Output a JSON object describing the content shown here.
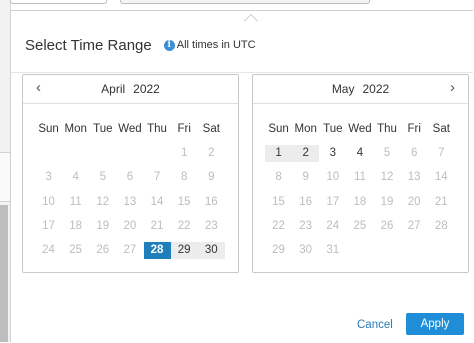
{
  "header": {
    "title": "Select Time Range",
    "info_icon": "i",
    "info_text": "All times in UTC"
  },
  "weekdays": [
    "Sun",
    "Mon",
    "Tue",
    "Wed",
    "Thu",
    "Fri",
    "Sat"
  ],
  "left_month": {
    "month": "April",
    "year": "2022",
    "prev_icon": "‹",
    "weeks": [
      [
        {
          "d": ""
        },
        {
          "d": ""
        },
        {
          "d": ""
        },
        {
          "d": ""
        },
        {
          "d": ""
        },
        {
          "d": "1"
        },
        {
          "d": "2"
        }
      ],
      [
        {
          "d": "3"
        },
        {
          "d": "4"
        },
        {
          "d": "5"
        },
        {
          "d": "6"
        },
        {
          "d": "7"
        },
        {
          "d": "8"
        },
        {
          "d": "9"
        }
      ],
      [
        {
          "d": "10"
        },
        {
          "d": "11"
        },
        {
          "d": "12"
        },
        {
          "d": "13"
        },
        {
          "d": "14"
        },
        {
          "d": "15"
        },
        {
          "d": "16"
        }
      ],
      [
        {
          "d": "17"
        },
        {
          "d": "18"
        },
        {
          "d": "19"
        },
        {
          "d": "20"
        },
        {
          "d": "21"
        },
        {
          "d": "22"
        },
        {
          "d": "23"
        }
      ],
      [
        {
          "d": "24"
        },
        {
          "d": "25"
        },
        {
          "d": "26"
        },
        {
          "d": "27"
        },
        {
          "d": "28",
          "s": "selected"
        },
        {
          "d": "29",
          "s": "range"
        },
        {
          "d": "30",
          "s": "range"
        }
      ]
    ]
  },
  "right_month": {
    "month": "May",
    "year": "2022",
    "next_icon": "›",
    "weeks": [
      [
        {
          "d": "1",
          "s": "range"
        },
        {
          "d": "2",
          "s": "range"
        },
        {
          "d": "3",
          "s": "active"
        },
        {
          "d": "4",
          "s": "active"
        },
        {
          "d": "5"
        },
        {
          "d": "6"
        },
        {
          "d": "7"
        }
      ],
      [
        {
          "d": "8"
        },
        {
          "d": "9"
        },
        {
          "d": "10"
        },
        {
          "d": "11"
        },
        {
          "d": "12"
        },
        {
          "d": "13"
        },
        {
          "d": "14"
        }
      ],
      [
        {
          "d": "15"
        },
        {
          "d": "16"
        },
        {
          "d": "17"
        },
        {
          "d": "18"
        },
        {
          "d": "19"
        },
        {
          "d": "20"
        },
        {
          "d": "21"
        }
      ],
      [
        {
          "d": "22"
        },
        {
          "d": "23"
        },
        {
          "d": "24"
        },
        {
          "d": "25"
        },
        {
          "d": "26"
        },
        {
          "d": "27"
        },
        {
          "d": "28"
        }
      ],
      [
        {
          "d": "29"
        },
        {
          "d": "30"
        },
        {
          "d": "31"
        },
        {
          "d": ""
        },
        {
          "d": ""
        },
        {
          "d": ""
        },
        {
          "d": ""
        }
      ]
    ]
  },
  "footer": {
    "cancel_label": "Cancel",
    "apply_label": "Apply"
  },
  "colors": {
    "selected": "#1f7fbb",
    "range": "#ececec",
    "apply_button": "#1f8ed6",
    "cancel_link": "#2a7ab8",
    "info_icon": "#3b8fd3"
  }
}
